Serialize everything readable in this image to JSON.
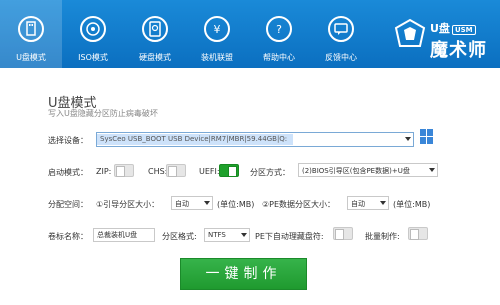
{
  "nav": {
    "items": [
      {
        "label": "U盘模式",
        "icon": "usb-drive-icon"
      },
      {
        "label": "ISO模式",
        "icon": "disc-icon"
      },
      {
        "label": "硬盘模式",
        "icon": "hard-disk-icon"
      },
      {
        "label": "装机联盟",
        "icon": "star-money-icon"
      },
      {
        "label": "帮助中心",
        "icon": "help-icon"
      },
      {
        "label": "反馈中心",
        "icon": "feedback-icon"
      }
    ]
  },
  "brand": {
    "top": "U盘",
    "usm": "USM",
    "name": "魔术师"
  },
  "page": {
    "title": "U盘模式",
    "subtitle": "写入U盘隐藏分区防止病毒破坏"
  },
  "device": {
    "label": "选择设备：",
    "value": "SysCeo USB_BOOT USB Device|RM7|MBR|59.44GB|Q:"
  },
  "boot_mode": {
    "label": "启动模式：",
    "zip": "ZIP:",
    "zip_on": false,
    "chs": "CHS:",
    "chs_on": false,
    "uefi": "UEFI:",
    "uefi_on": true,
    "partition_method_label": "分区方式：",
    "partition_method_value": "(2)BIOS引导区(包含PE数据)+U盘"
  },
  "space": {
    "label": "分配空间：",
    "boot_size_label": "①引导分区大小：",
    "boot_size_value": "自动",
    "boot_unit": "(单位:MB)",
    "pe_size_label": "②PE数据分区大小：",
    "pe_size_value": "自动",
    "pe_unit": "(单位:MB)"
  },
  "volume": {
    "label": "卷标名称：",
    "name_value": "总裁装机U盘",
    "format_label": "分区格式:",
    "format_value": "NTFS",
    "auto_clean_label": "PE下自动理藏盘符:",
    "auto_clean_on": false,
    "batch_label": "批量制作:",
    "batch_on": false
  },
  "action": {
    "make_label": "一键制作"
  },
  "colors": {
    "header": "#0f77c9",
    "accent_green": "#24a235"
  }
}
